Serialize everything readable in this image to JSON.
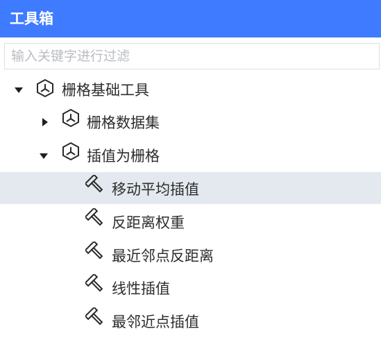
{
  "panel": {
    "title": "工具箱",
    "search_placeholder": "输入关键字进行过滤"
  },
  "tree": {
    "root": {
      "label": "栅格基础工具",
      "icon": "cube-icon",
      "expanded": true
    },
    "group_dataset": {
      "label": "栅格数据集",
      "icon": "cube-icon",
      "expanded": false
    },
    "group_interp": {
      "label": "插值为栅格",
      "icon": "cube-icon",
      "expanded": true
    },
    "tools": [
      {
        "label": "移动平均插值",
        "icon": "hammer-icon",
        "selected": true
      },
      {
        "label": "反距离权重",
        "icon": "hammer-icon",
        "selected": false
      },
      {
        "label": "最近邻点反距离",
        "icon": "hammer-icon",
        "selected": false
      },
      {
        "label": "线性插值",
        "icon": "hammer-icon",
        "selected": false
      },
      {
        "label": "最邻近点插值",
        "icon": "hammer-icon",
        "selected": false
      }
    ]
  },
  "colors": {
    "title_bar": "#3f7bff",
    "selected_row": "#e3e9ee",
    "text": "#2d2d2d",
    "placeholder": "#b9bcc2"
  }
}
